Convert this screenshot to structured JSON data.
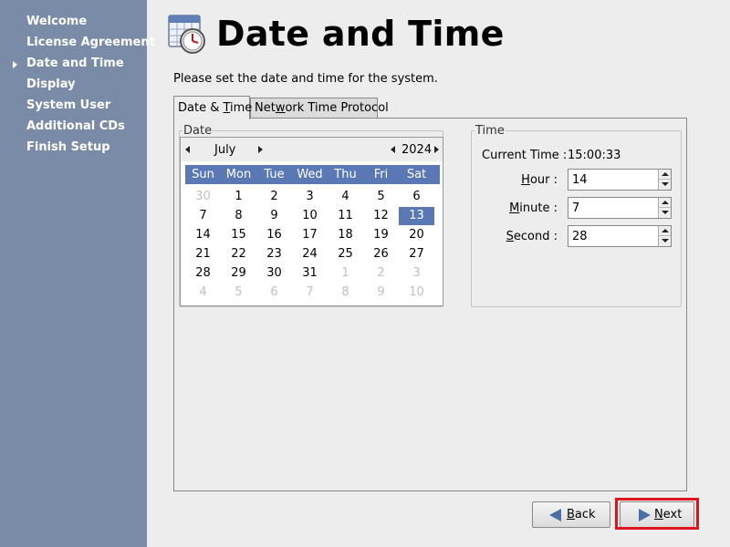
{
  "sidebar": {
    "items": [
      {
        "label": "Welcome"
      },
      {
        "label": "License Agreement"
      },
      {
        "label": "Date and Time"
      },
      {
        "label": "Display"
      },
      {
        "label": "System User"
      },
      {
        "label": "Additional CDs"
      },
      {
        "label": "Finish Setup"
      }
    ],
    "current_index": 2
  },
  "header": {
    "title": "Date and Time",
    "icon": "calendar-clock-icon"
  },
  "instructions": "Please set the date and time for the system.",
  "tabs": [
    {
      "pre": "Date & ",
      "mnemonic": "T",
      "post": "ime",
      "active": true
    },
    {
      "pre": "Net",
      "mnemonic": "w",
      "post": "ork Time Protocol",
      "active": false
    }
  ],
  "date_frame": {
    "label": "Date"
  },
  "calendar": {
    "month": "July",
    "year": "2024",
    "weekdays": [
      "Sun",
      "Mon",
      "Tue",
      "Wed",
      "Thu",
      "Fri",
      "Sat"
    ],
    "weeks": [
      [
        "30",
        "1",
        "2",
        "3",
        "4",
        "5",
        "6"
      ],
      [
        "7",
        "8",
        "9",
        "10",
        "11",
        "12",
        "13"
      ],
      [
        "14",
        "15",
        "16",
        "17",
        "18",
        "19",
        "20"
      ],
      [
        "21",
        "22",
        "23",
        "24",
        "25",
        "26",
        "27"
      ],
      [
        "28",
        "29",
        "30",
        "31",
        "1",
        "2",
        "3"
      ],
      [
        "4",
        "5",
        "6",
        "7",
        "8",
        "9",
        "10"
      ]
    ],
    "selected_day": "13"
  },
  "time_frame": {
    "label": "Time",
    "current_time_label": "Current Time :",
    "current_time": "15:00:33",
    "hour": {
      "pre": "",
      "mnemonic": "H",
      "post": "our :",
      "value": "14"
    },
    "minute": {
      "pre": "",
      "mnemonic": "M",
      "post": "inute :",
      "value": "7"
    },
    "second": {
      "pre": "",
      "mnemonic": "S",
      "post": "econd :",
      "value": "28"
    }
  },
  "buttons": {
    "back": {
      "mnemonic": "B",
      "post": "ack"
    },
    "next": {
      "mnemonic": "N",
      "post": "ext"
    }
  },
  "colors": {
    "sidebar": "#7a8ba8",
    "selection": "#5a78b3",
    "highlight": "#e0141e"
  }
}
